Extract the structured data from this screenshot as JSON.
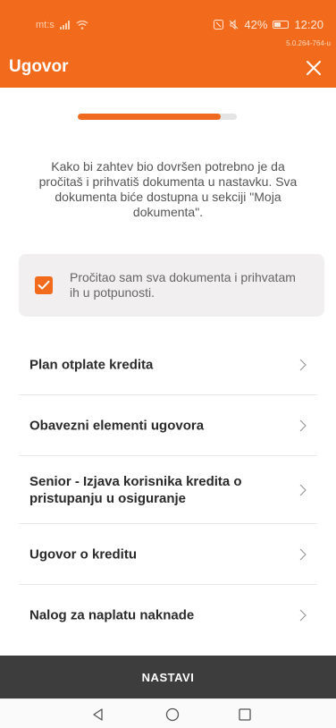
{
  "status_bar": {
    "carrier": "mt:s",
    "battery": "42%",
    "time": "12:20",
    "version": "5.0.264-764-u"
  },
  "header": {
    "title": "Ugovor",
    "close_icon": "close-icon"
  },
  "progress": {
    "value": 0.9
  },
  "intro_text": "Kako bi zahtev bio dovršen potrebno je da pročitaš i prihvatiš dokumenta u nastavku. Sva dokumenta biće dostupna u sekciji \"Moja dokumenta\".",
  "consent": {
    "checked": true,
    "label": "Pročitao sam sva dokumenta i prihvatam ih u potpunosti."
  },
  "documents": [
    {
      "label": "Plan otplate kredita"
    },
    {
      "label": "Obavezni elementi ugovora"
    },
    {
      "label": "Senior - Izjava korisnika kredita o pristupanju u osiguranje"
    },
    {
      "label": "Ugovor o kreditu"
    },
    {
      "label": "Nalog za naplatu naknade"
    }
  ],
  "primary_button": {
    "label": "NASTAVI"
  },
  "nav": {
    "back_icon": "back-triangle-icon",
    "home_icon": "home-circle-icon",
    "recents_icon": "recents-square-icon"
  },
  "colors": {
    "brand": "#f26b1d",
    "button_dark": "#3d3d3d"
  }
}
